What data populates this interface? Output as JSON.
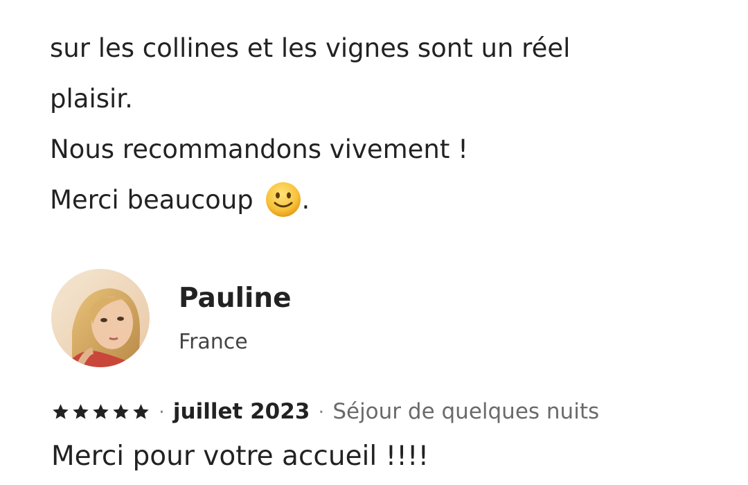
{
  "previous_review": {
    "lines": [
      "sur les collines et les vignes sont un réel",
      "plaisir.",
      "Nous recommandons vivement !",
      "Merci beaucoup"
    ],
    "closing_punctuation": ".",
    "emoji": "slightly-smiling-face-emoji"
  },
  "review": {
    "reviewer_name": "Pauline",
    "reviewer_country": "France",
    "rating": 5,
    "rating_max": 5,
    "separator": "·",
    "date": "juillet 2023",
    "stay_type": "Séjour de quelques nuits",
    "text": "Merci pour votre accueil !!!!"
  },
  "colors": {
    "text": "#222222",
    "muted": "#6a6a6a",
    "star": "#222222",
    "emoji_face": "#F7C23A"
  }
}
